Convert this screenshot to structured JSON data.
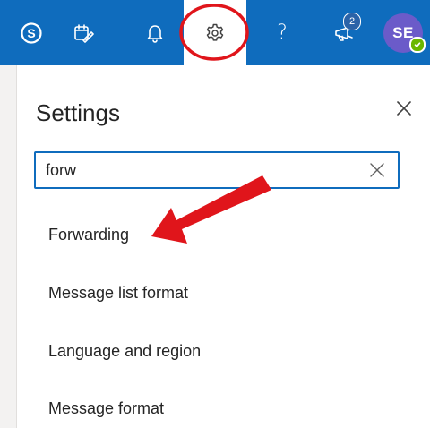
{
  "header": {
    "notification_count": "2",
    "avatar_initials": "SE",
    "help_glyph": "?",
    "icons": [
      "skype-icon",
      "todo-icon",
      "bell-icon",
      "gear-icon",
      "help-icon",
      "feedback-icon",
      "avatar"
    ]
  },
  "settings": {
    "title": "Settings",
    "search": {
      "value": "forw"
    },
    "results": [
      {
        "label": "Forwarding"
      },
      {
        "label": "Message list format"
      },
      {
        "label": "Language and region"
      },
      {
        "label": "Message format"
      }
    ]
  },
  "colors": {
    "brand_blue": "#0f6cbd",
    "avatar_purple": "#6b5bc9",
    "presence_green": "#6bb700",
    "annotation_red": "#e0151b"
  }
}
